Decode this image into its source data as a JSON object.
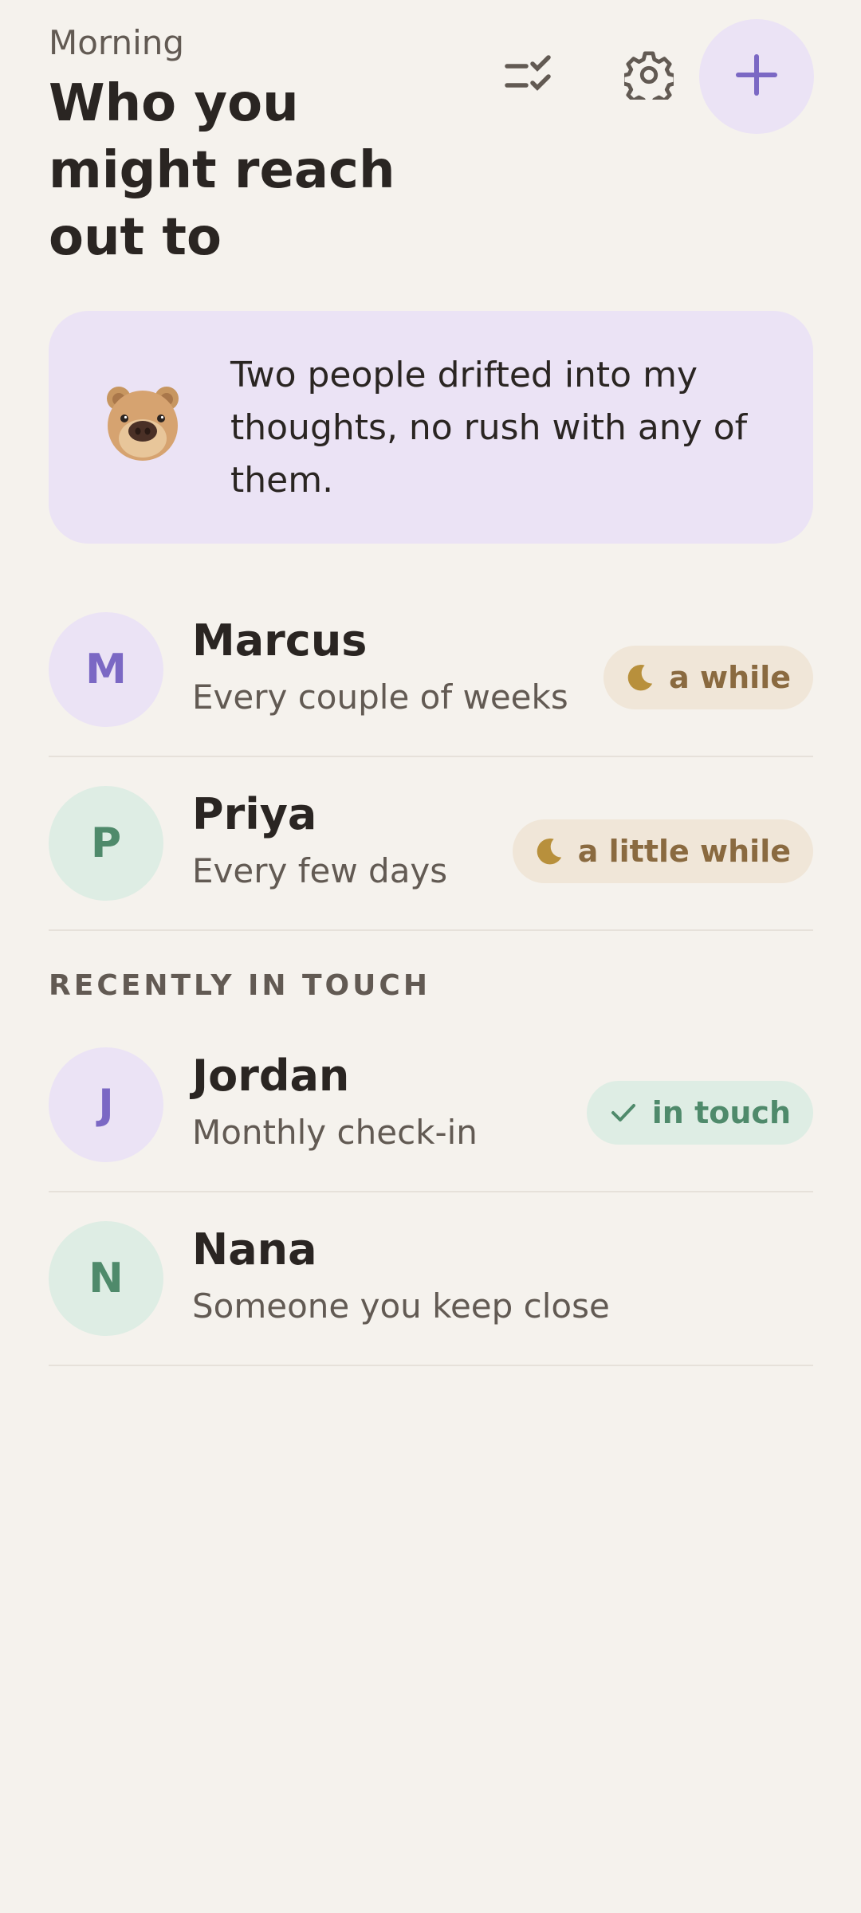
{
  "header": {
    "greeting": "Morning",
    "title": "Who you might reach out to",
    "buttons": [
      {
        "name": "tasks",
        "icon": "checklist-icon"
      },
      {
        "name": "settings",
        "icon": "gear-icon"
      },
      {
        "name": "add",
        "icon": "plus-icon"
      }
    ]
  },
  "note": {
    "icon": "bear-icon",
    "text": "Two people drifted into my thoughts, no rush with any of them."
  },
  "due": [
    {
      "initial": "M",
      "name": "Marcus",
      "cadence": "Every couple of weeks",
      "status": "a while",
      "status_icon": "moon-icon"
    },
    {
      "initial": "P",
      "name": "Priya",
      "cadence": "Every few days",
      "status": "a little while",
      "status_icon": "moon-icon"
    }
  ],
  "recent_section": {
    "label": "RECENTLY IN TOUCH"
  },
  "recent": [
    {
      "initial": "J",
      "name": "Jordan",
      "cadence": "Monthly check-in",
      "status": "in touch",
      "status_icon": "check-icon"
    },
    {
      "initial": "N",
      "name": "Nana",
      "cadence": "Someone you keep close"
    }
  ],
  "colors": {
    "background": "#f5f2ed",
    "accent_purple": "#7b68c4",
    "lavender": "#ebe3f5",
    "mint": "#deede4",
    "green": "#4f8a6b",
    "amber": "#b8903c"
  }
}
